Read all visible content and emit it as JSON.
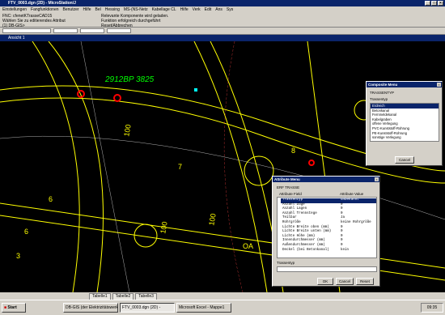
{
  "window": {
    "title": "FTV_0003.dgn (2D) - MicroStation/J"
  },
  "menu": [
    "Einstellungen",
    "Fangfunktionen",
    "Benutzer",
    "Hilfe",
    "Bel",
    "Hessing",
    "MS-(NS-Netz",
    "Kabellage CL",
    "Hilfe",
    "Verk",
    "Edit",
    "Ans",
    "Sys"
  ],
  "status": {
    "line1": "FNC: cfenetKTrasseCAD15",
    "line2": "Wählen Sie zu editierendes Attribut",
    "line3": "(1) DB-GIS>",
    "msg1": "Relevante Komponente wird geladen.",
    "msg2": "Funktion erfolgreich durchgeführt",
    "msg3": "Reset/Abbrechen"
  },
  "view": {
    "title": "Ansicht 1"
  },
  "tabs": [
    "Tabelle1",
    "Tabelle2",
    "Tabelle3"
  ],
  "canvas_labels": [
    "2912BP 3825",
    "7",
    "6",
    "100",
    "100",
    "100",
    "8",
    "OA",
    "3",
    "6"
  ],
  "dialog1": {
    "title": "Composite Menu",
    "heading": "TRASSENTYP",
    "subheading": "Trassentyp",
    "items": [
      "Erdreich",
      "Betonkanal",
      "Fernmeldekanal",
      "Kabelgraben",
      "offene Verlegung",
      "PVC-Kunststoff-Rohrung",
      "PE-Kunststoff-Rohrung",
      "sonstige Verlegung"
    ],
    "selected": 0,
    "cancel": "Cancel"
  },
  "dialog2": {
    "title": "Attribute Menu",
    "heading": "ERF TRASSE",
    "col1": "Attribute Field",
    "col2": "Attribute Value",
    "rows": [
      [
        "Trassentyp",
        "unbekannt"
      ],
      [
        "Anzahl Züge",
        "0"
      ],
      [
        "Anzahl Lagen",
        "0"
      ],
      [
        "Anzahl Trennstege",
        "0"
      ],
      [
        "Teilbar",
        "Ja"
      ],
      [
        "Rohrgröße",
        "keine Rohrgröße"
      ],
      [
        "Lichte Breite oben (mm)",
        "0"
      ],
      [
        "Lichte Breite unten (mm)",
        "0"
      ],
      [
        "Lichte Höhe (mm)",
        "0"
      ],
      [
        "Innendurchmesser (mm)",
        "0"
      ],
      [
        "Außendurchmesser (mm)",
        "0"
      ],
      [
        "Deckel (bei Betonkanal)",
        "kein"
      ]
    ],
    "selected": 0,
    "field_label": "Trassentyp",
    "ok": "OK",
    "cancel": "Cancel",
    "reset": "Reset"
  },
  "taskbar": {
    "start": "Start",
    "items": [
      "DB-GIS (der Elektrizitätswerk",
      "FTV_0003.dgn (2D) -",
      "Microsoft Excel - Mappe1"
    ],
    "clock": "09:35"
  },
  "colors": {
    "lines": "#ffff00",
    "text": "#00ff00",
    "accent": "#ff0000",
    "highlight": "#00ffff"
  }
}
